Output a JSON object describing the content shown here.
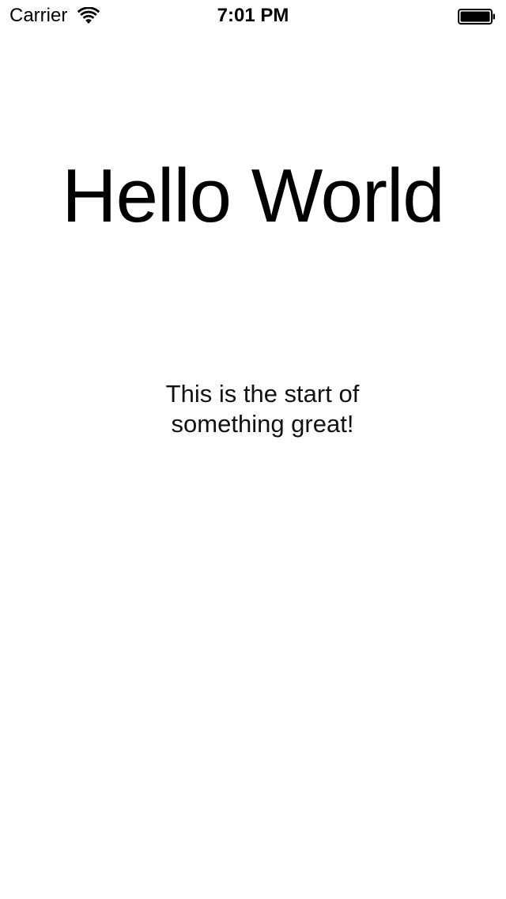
{
  "status_bar": {
    "carrier": "Carrier",
    "time": "7:01 PM",
    "wifi_icon": "wifi-icon",
    "battery_icon": "battery-icon",
    "battery_level": 1.0
  },
  "main": {
    "title": "Hello World",
    "subtitle": "This is the start of something great!"
  },
  "colors": {
    "background": "#ffffff",
    "text": "#000000"
  }
}
